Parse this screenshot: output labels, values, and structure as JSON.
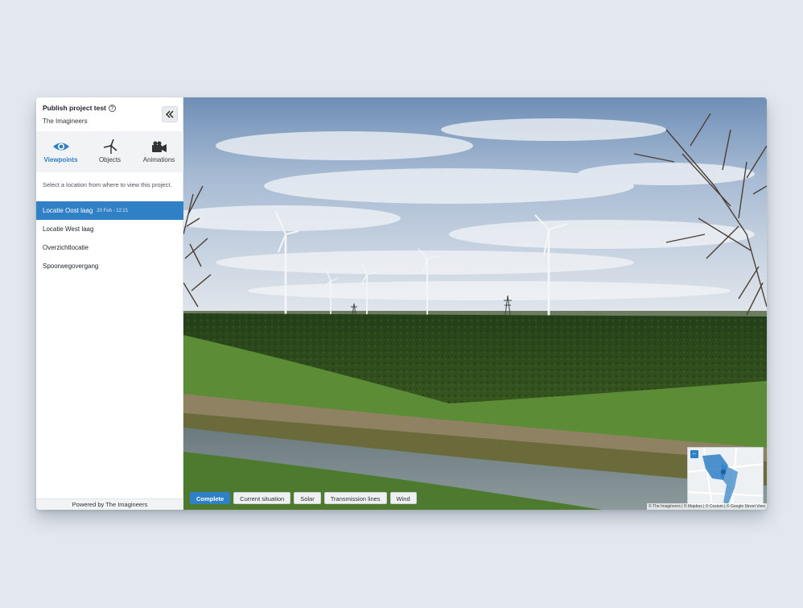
{
  "project": {
    "title": "Publish project test",
    "organization": "The Imagineers"
  },
  "tabs": [
    {
      "label": "Viewpoints",
      "icon": "eye-icon",
      "active": true
    },
    {
      "label": "Objects",
      "icon": "wind-turbine-icon",
      "active": false
    },
    {
      "label": "Animations",
      "icon": "video-camera-icon",
      "active": false
    }
  ],
  "viewpoints": {
    "description": "Select a location from where to view this project.",
    "items": [
      {
        "label": "Locatie Oost laag",
        "meta": "20 Feb - 12:21",
        "active": true
      },
      {
        "label": "Locatie West laag",
        "meta": ""
      },
      {
        "label": "Overzichtlocatie",
        "meta": ""
      },
      {
        "label": "Spoorwegovergang",
        "meta": ""
      }
    ]
  },
  "footer": {
    "text": "Powered by The Imagineers"
  },
  "layers": [
    {
      "label": "Complete",
      "active": true
    },
    {
      "label": "Current situation",
      "active": false
    },
    {
      "label": "Solar",
      "active": false
    },
    {
      "label": "Transmission lines",
      "active": false
    },
    {
      "label": "Wind",
      "active": false
    }
  ],
  "attribution": "© The Imagineers | © Mapbox | © Cesium | © Google Street View",
  "colors": {
    "accent": "#2f80c5",
    "sky": "#aebfd2",
    "hedge": "#2c4a1c",
    "grass": "#5f8f3a"
  }
}
